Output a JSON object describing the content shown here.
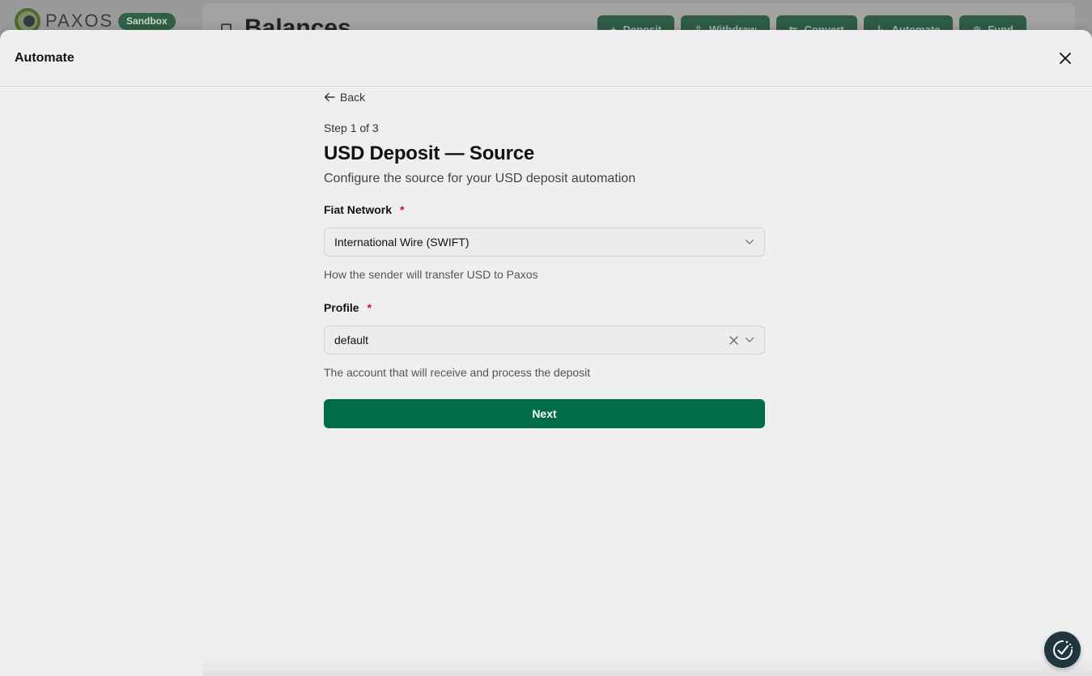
{
  "background": {
    "logo_text": "PAXOS",
    "badge": "Sandbox",
    "title": "Balances",
    "actions": [
      {
        "label": "Deposit",
        "icon": "plus-icon"
      },
      {
        "label": "Withdraw",
        "icon": "upload-icon"
      },
      {
        "label": "Convert",
        "icon": "swap-icon"
      },
      {
        "label": "Automate",
        "icon": "automate-icon"
      },
      {
        "label": "Fund",
        "icon": "dollar-circle-icon"
      }
    ]
  },
  "modal": {
    "title": "Automate",
    "close_icon": "close-icon"
  },
  "form": {
    "back_label": "Back",
    "step_label": "Step 1 of 3",
    "title": "USD Deposit — Source",
    "subtitle": "Configure the source for your USD deposit automation",
    "fields": [
      {
        "label": "Fiat Network",
        "required_mark": "*",
        "value": "International Wire (SWIFT)",
        "helper": "How the sender will transfer USD to Paxos",
        "clearable": false
      },
      {
        "label": "Profile",
        "required_mark": "*",
        "value": "default",
        "helper": "The account that will receive and process the deposit",
        "clearable": true
      }
    ],
    "next_label": "Next"
  },
  "colors": {
    "primary": "#006c48",
    "required": "#c8102e",
    "fab": "#1f3641"
  }
}
